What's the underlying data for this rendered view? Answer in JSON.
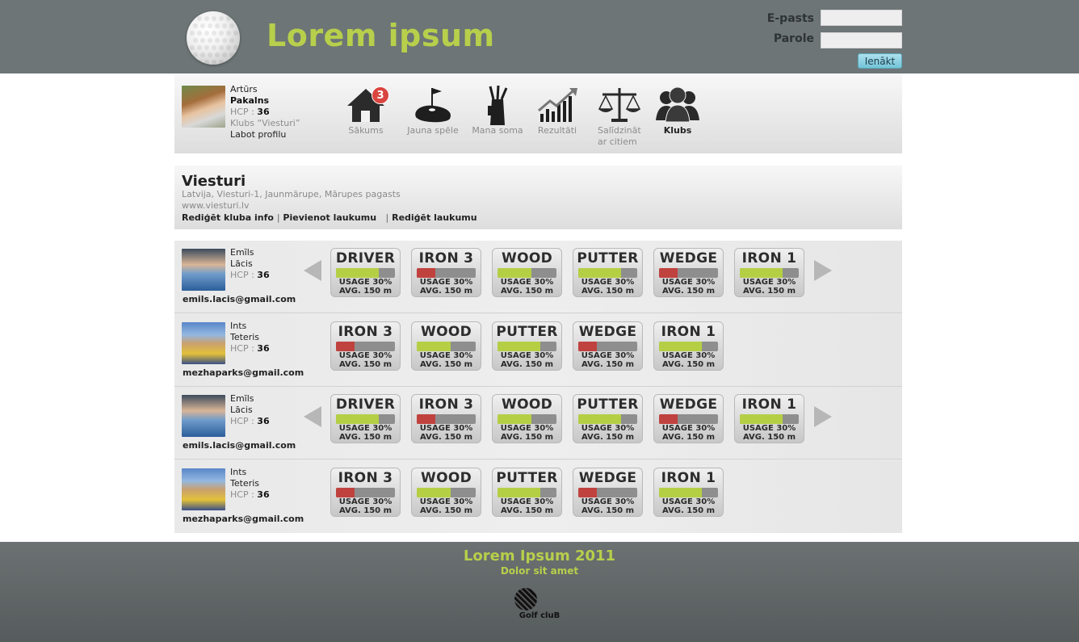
{
  "header": {
    "title": "Lorem ipsum",
    "email_label": "E-pasts",
    "password_label": "Parole",
    "email_value": "",
    "password_value": "",
    "login_button": "Ienākt"
  },
  "profile": {
    "first_name": "Artūrs",
    "last_name": "Pakalns",
    "hcp_label": "HCP : ",
    "hcp_value": "36",
    "club_label": "Klubs “Viesturi”",
    "edit_profile": "Labot profilu"
  },
  "nav": [
    {
      "label": "Sākums",
      "icon": "home-icon",
      "badge": "3",
      "active": false
    },
    {
      "label": "Jauna spēle",
      "icon": "golf-hole-icon",
      "active": false
    },
    {
      "label": "Mana soma",
      "icon": "golf-bag-icon",
      "active": false
    },
    {
      "label": "Rezultāti",
      "icon": "chart-icon",
      "active": false
    },
    {
      "label": "Salīdzināt ar citiem",
      "label_line1": "Salīdzināt",
      "label_line2": "ar citiem",
      "icon": "scales-icon",
      "active": false
    },
    {
      "label": "Klubs",
      "icon": "group-icon",
      "active": true
    }
  ],
  "club": {
    "name": "Viesturi",
    "address": "Latvija, Viesturi-1, Jaunmārupe, Mārupes pagasts",
    "website": "www.viesturi.lv",
    "links": [
      "Rediģēt kluba info",
      "Pievienot laukumu",
      "Rediģēt laukumu"
    ],
    "separator": "|"
  },
  "colors": {
    "accent": "#b7cf4b",
    "header_bg": "#6d7576",
    "bar_good": "#b5cf45",
    "bar_bad": "#c0423f"
  },
  "players": [
    {
      "first_name": "Emīls",
      "last_name": "Lācis",
      "hcp_label": "HCP : ",
      "hcp_value": "36",
      "email": "emils.lacis@gmail.com",
      "arrows": true,
      "clubs": [
        {
          "name": "DRIVER",
          "usage": "USAGE 30%",
          "avg": "AVG. 150 m",
          "level": 0.72,
          "status": "good"
        },
        {
          "name": "IRON 3",
          "usage": "USAGE 30%",
          "avg": "AVG. 150 m",
          "level": 0.32,
          "status": "bad"
        },
        {
          "name": "WOOD",
          "usage": "USAGE 30%",
          "avg": "AVG. 150 m",
          "level": 0.58,
          "status": "good"
        },
        {
          "name": "PUTTER",
          "usage": "USAGE 30%",
          "avg": "AVG. 150 m",
          "level": 0.72,
          "status": "good"
        },
        {
          "name": "WEDGE",
          "usage": "USAGE 30%",
          "avg": "AVG. 150 m",
          "level": 0.32,
          "status": "bad"
        },
        {
          "name": "IRON 1",
          "usage": "USAGE 30%",
          "avg": "AVG. 150 m",
          "level": 0.72,
          "status": "good"
        }
      ]
    },
    {
      "first_name": "Ints",
      "last_name": "Teteris",
      "hcp_label": "HCP : ",
      "hcp_value": "36",
      "email": "mezhaparks@gmail.com",
      "arrows": false,
      "clubs": [
        {
          "name": "IRON 3",
          "usage": "USAGE 30%",
          "avg": "AVG. 150 m",
          "level": 0.32,
          "status": "bad"
        },
        {
          "name": "WOOD",
          "usage": "USAGE 30%",
          "avg": "AVG. 150 m",
          "level": 0.58,
          "status": "good"
        },
        {
          "name": "PUTTER",
          "usage": "USAGE 30%",
          "avg": "AVG. 150 m",
          "level": 0.72,
          "status": "good"
        },
        {
          "name": "WEDGE",
          "usage": "USAGE 30%",
          "avg": "AVG. 150 m",
          "level": 0.32,
          "status": "bad"
        },
        {
          "name": "IRON 1",
          "usage": "USAGE 30%",
          "avg": "AVG. 150 m",
          "level": 0.72,
          "status": "good"
        }
      ]
    },
    {
      "first_name": "Emīls",
      "last_name": "Lācis",
      "hcp_label": "HCP : ",
      "hcp_value": "36",
      "email": "emils.lacis@gmail.com",
      "arrows": true,
      "clubs": [
        {
          "name": "DRIVER",
          "usage": "USAGE 30%",
          "avg": "AVG. 150 m",
          "level": 0.72,
          "status": "good"
        },
        {
          "name": "IRON 3",
          "usage": "USAGE 30%",
          "avg": "AVG. 150 m",
          "level": 0.32,
          "status": "bad"
        },
        {
          "name": "WOOD",
          "usage": "USAGE 30%",
          "avg": "AVG. 150 m",
          "level": 0.58,
          "status": "good"
        },
        {
          "name": "PUTTER",
          "usage": "USAGE 30%",
          "avg": "AVG. 150 m",
          "level": 0.72,
          "status": "good"
        },
        {
          "name": "WEDGE",
          "usage": "USAGE 30%",
          "avg": "AVG. 150 m",
          "level": 0.32,
          "status": "bad"
        },
        {
          "name": "IRON 1",
          "usage": "USAGE 30%",
          "avg": "AVG. 150 m",
          "level": 0.72,
          "status": "good"
        }
      ]
    },
    {
      "first_name": "Ints",
      "last_name": "Teteris",
      "hcp_label": "HCP : ",
      "hcp_value": "36",
      "email": "mezhaparks@gmail.com",
      "arrows": false,
      "clubs": [
        {
          "name": "IRON 3",
          "usage": "USAGE 30%",
          "avg": "AVG. 150 m",
          "level": 0.32,
          "status": "bad"
        },
        {
          "name": "WOOD",
          "usage": "USAGE 30%",
          "avg": "AVG. 150 m",
          "level": 0.58,
          "status": "good"
        },
        {
          "name": "PUTTER",
          "usage": "USAGE 30%",
          "avg": "AVG. 150 m",
          "level": 0.72,
          "status": "good"
        },
        {
          "name": "WEDGE",
          "usage": "USAGE 30%",
          "avg": "AVG. 150 m",
          "level": 0.32,
          "status": "bad"
        },
        {
          "name": "IRON 1",
          "usage": "USAGE 30%",
          "avg": "AVG. 150 m",
          "level": 0.72,
          "status": "good"
        }
      ]
    }
  ],
  "footer": {
    "title": "Lorem Ipsum 2011",
    "subtitle": "Dolor sit amet",
    "logo_text": "Golf cluB"
  }
}
